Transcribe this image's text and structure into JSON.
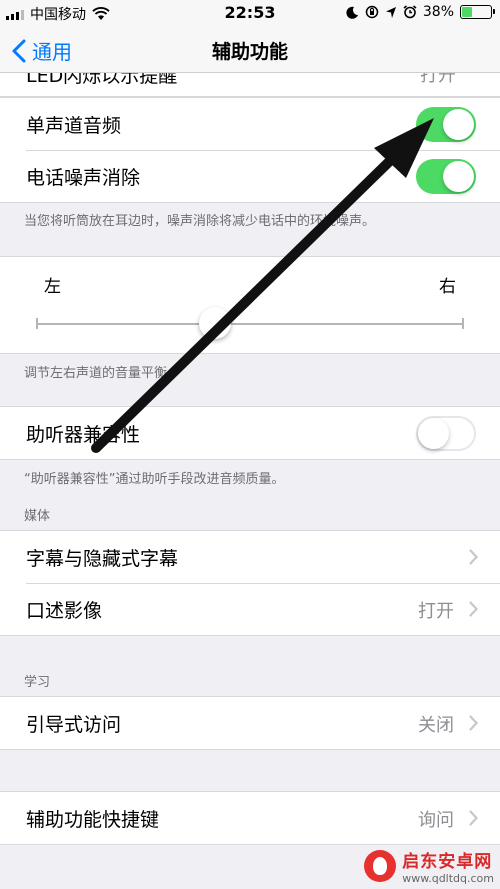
{
  "status": {
    "carrier": "中国移动",
    "time": "22:53",
    "battery_percent": "38%",
    "battery_level": 0.38
  },
  "nav": {
    "back_label": "通用",
    "title": "辅助功能"
  },
  "top_cut_row": {
    "label": "LED闪烁以示提醒",
    "value": "打开"
  },
  "audio_group": {
    "mono_audio_label": "单声道音频",
    "mono_audio_on": true,
    "noise_cancel_label": "电话噪声消除",
    "noise_cancel_on": true,
    "footnote": "当您将听筒放在耳边时，噪声消除将减少电话中的环境噪声。"
  },
  "balance": {
    "left_label": "左",
    "right_label": "右",
    "value": 0.5,
    "footnote": "调节左右声道的音量平衡。"
  },
  "hearing": {
    "label": "助听器兼容性",
    "on": false,
    "footnote": "“助听器兼容性”通过助听手段改进音频质量。"
  },
  "media": {
    "header": "媒体",
    "subtitles_label": "字幕与隐藏式字幕",
    "audio_desc_label": "口述影像",
    "audio_desc_value": "打开"
  },
  "learning": {
    "header": "学习",
    "guided_access_label": "引导式访问",
    "guided_access_value": "关闭"
  },
  "shortcut": {
    "label": "辅助功能快捷键",
    "value": "询问"
  },
  "watermark": {
    "name": "启东安卓网",
    "url": "www.qdltdq.com"
  },
  "colors": {
    "accent": "#007aff",
    "toggle_on": "#4cd964",
    "background": "#efeff4"
  }
}
